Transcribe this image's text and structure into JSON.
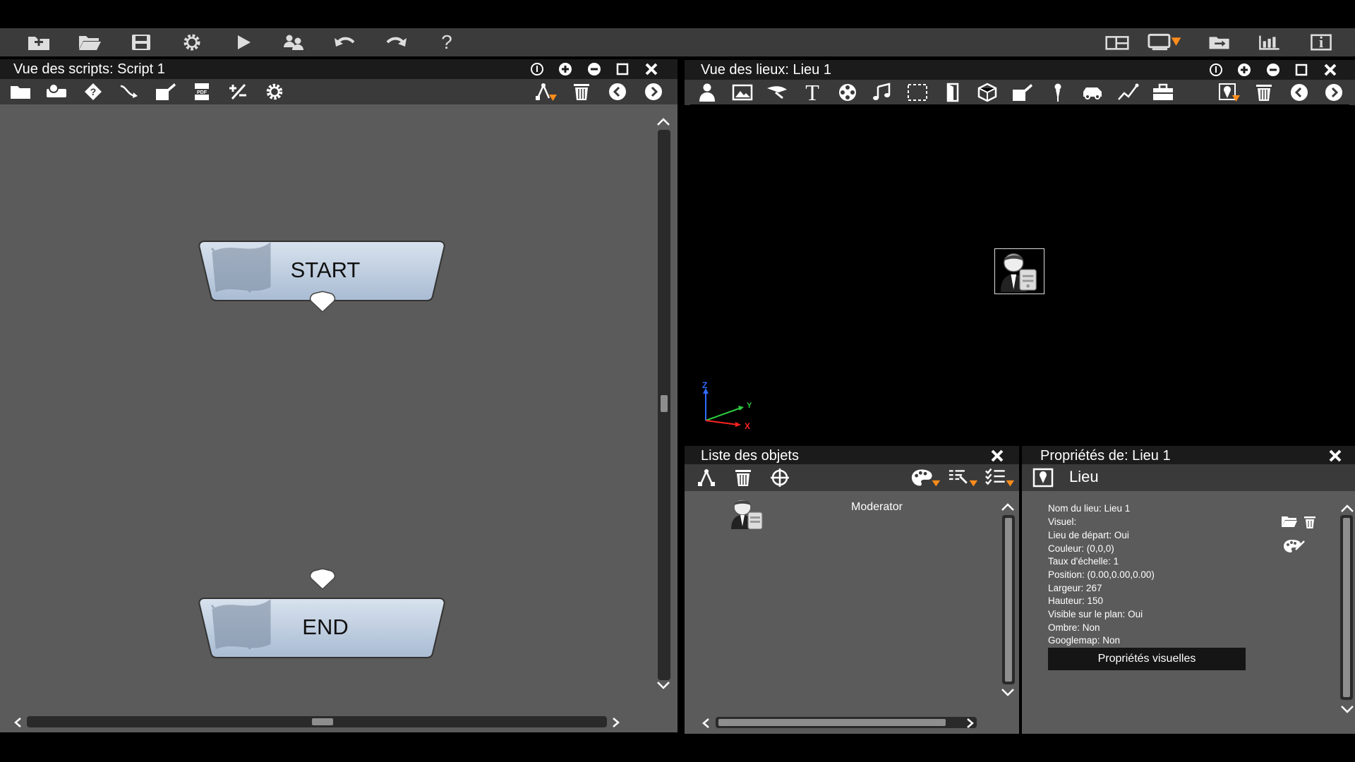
{
  "main_toolbar": {
    "icons": [
      "new-folder-icon",
      "open-folder-icon",
      "save-icon",
      "settings-gear-icon",
      "play-icon",
      "users-icon",
      "undo-icon",
      "redo-icon",
      "help-icon"
    ],
    "help_label": "?",
    "right_icons": [
      "layout-icon",
      "display-dropdown-icon",
      "export-icon",
      "stats-icon",
      "info-icon"
    ],
    "info_label": "i"
  },
  "script_panel": {
    "title": "Vue des scripts: Script 1",
    "nodes": [
      {
        "label": "START"
      },
      {
        "label": "END"
      }
    ],
    "toolbar_pdf": "PDF"
  },
  "places_panel": {
    "title": "Vue des lieux: Lieu 1",
    "axes": {
      "z": "Z",
      "y": "Y",
      "x": "X"
    },
    "text_tool": "T",
    "accent": "#ff8c1a"
  },
  "objects_panel": {
    "title": "Liste des objets",
    "items": [
      {
        "name": "Moderator"
      }
    ]
  },
  "properties_panel": {
    "title": "Propriétés de: Lieu 1",
    "header": "Lieu",
    "lines": [
      "Nom du lieu: Lieu 1",
      "Visuel:",
      "Lieu de départ: Oui",
      "Couleur: (0,0,0)",
      "Taux d'échelle: 1",
      "Position: (0.00,0.00,0.00)",
      "Largeur: 267",
      "Hauteur: 150",
      "Visible sur le plan: Oui",
      "Ombre: Non",
      "Googlemap: Non"
    ],
    "visual_button": "Propriétés visuelles"
  }
}
